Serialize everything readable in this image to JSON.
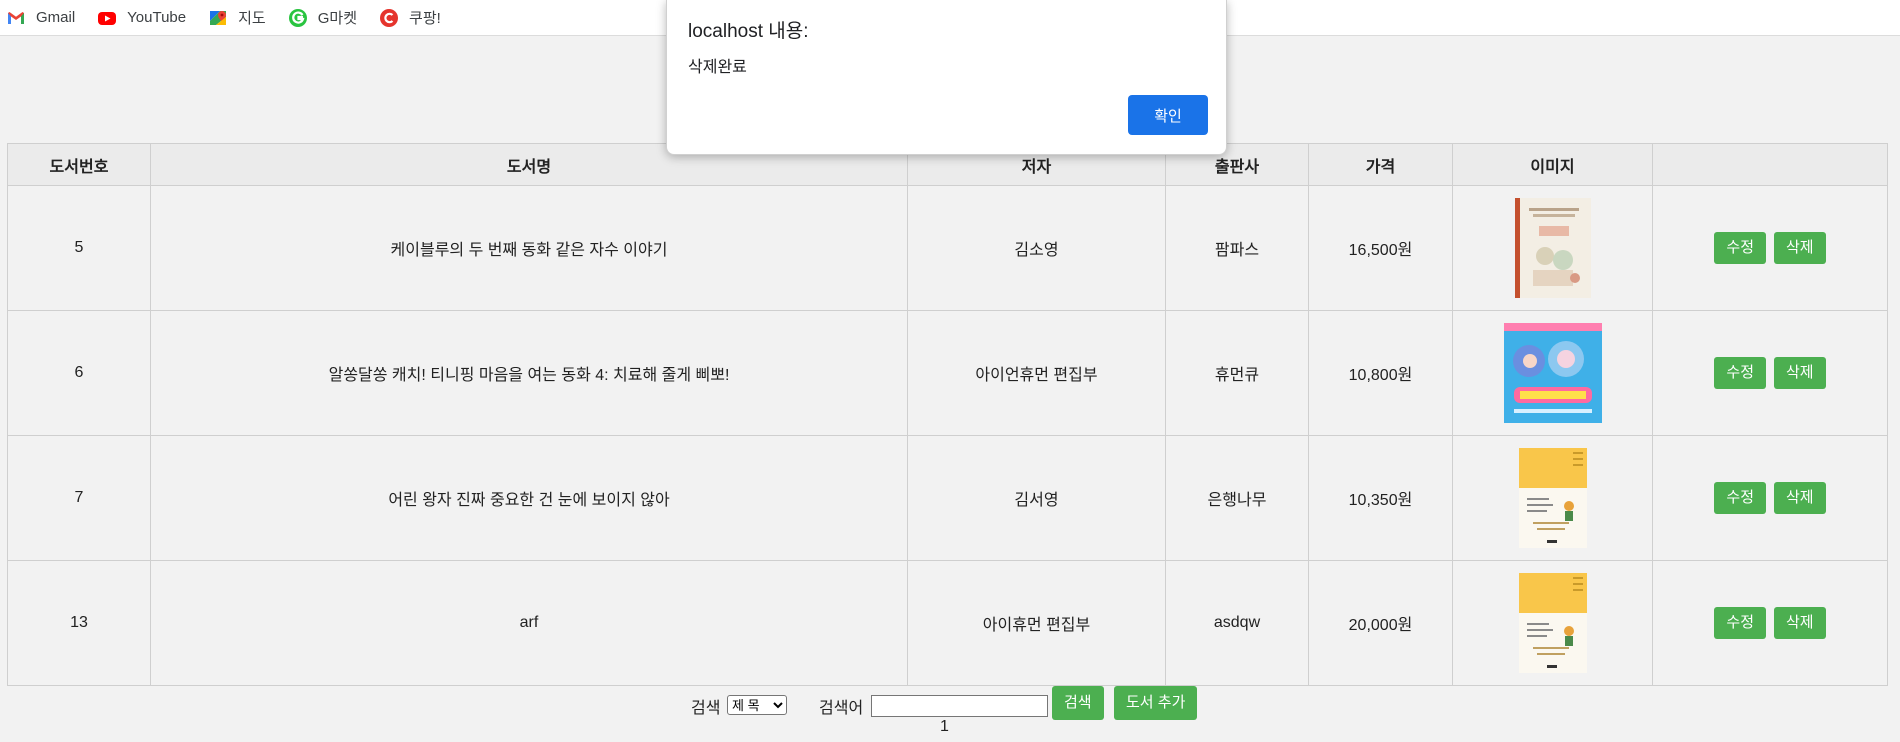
{
  "bookmarks": [
    {
      "label": "Gmail",
      "icon": "gmail-icon"
    },
    {
      "label": "YouTube",
      "icon": "youtube-icon"
    },
    {
      "label": "지도",
      "icon": "maps-icon"
    },
    {
      "label": "G마켓",
      "icon": "gmarket-icon"
    },
    {
      "label": "쿠팡!",
      "icon": "coupang-icon"
    }
  ],
  "dialog": {
    "title": "localhost 내용:",
    "message": "삭제완료",
    "ok_label": "확인"
  },
  "table": {
    "headers": [
      "도서번호",
      "도서명",
      "저자",
      "출판사",
      "가격",
      "이미지",
      ""
    ],
    "rows": [
      {
        "id": "5",
        "title": "케이블루의 두 번째 동화 같은 자수 이야기",
        "author": "김소영",
        "publisher": "팜파스",
        "price": "16,500원",
        "cover": "embroidery-book-cover"
      },
      {
        "id": "6",
        "title": "알쏭달쏭 캐치! 티니핑 마음을 여는 동화 4: 치료해 줄게 삐뽀!",
        "author": "아이언휴먼 편집부",
        "publisher": "휴먼큐",
        "price": "10,800원",
        "cover": "tinyping-book-cover"
      },
      {
        "id": "7",
        "title": "어린 왕자 진짜 중요한 건 눈에 보이지 않아",
        "author": "김서영",
        "publisher": "은행나무",
        "price": "10,350원",
        "cover": "little-prince-book-cover"
      },
      {
        "id": "13",
        "title": "arf",
        "author": "아이휴먼 편집부",
        "publisher": "asdqw",
        "price": "20,000원",
        "cover": "little-prince-book-cover"
      }
    ],
    "edit_label": "수정",
    "delete_label": "삭제"
  },
  "search": {
    "label": "검색",
    "select_value": "제 목",
    "keyword_label": "검색어",
    "keyword_value": "",
    "search_button": "검색",
    "add_button": "도서 추가"
  },
  "pagination": {
    "current": "1"
  },
  "colors": {
    "button_green": "#4caf50",
    "dialog_button_blue": "#1a73e8",
    "page_background": "#f2f2f2"
  }
}
